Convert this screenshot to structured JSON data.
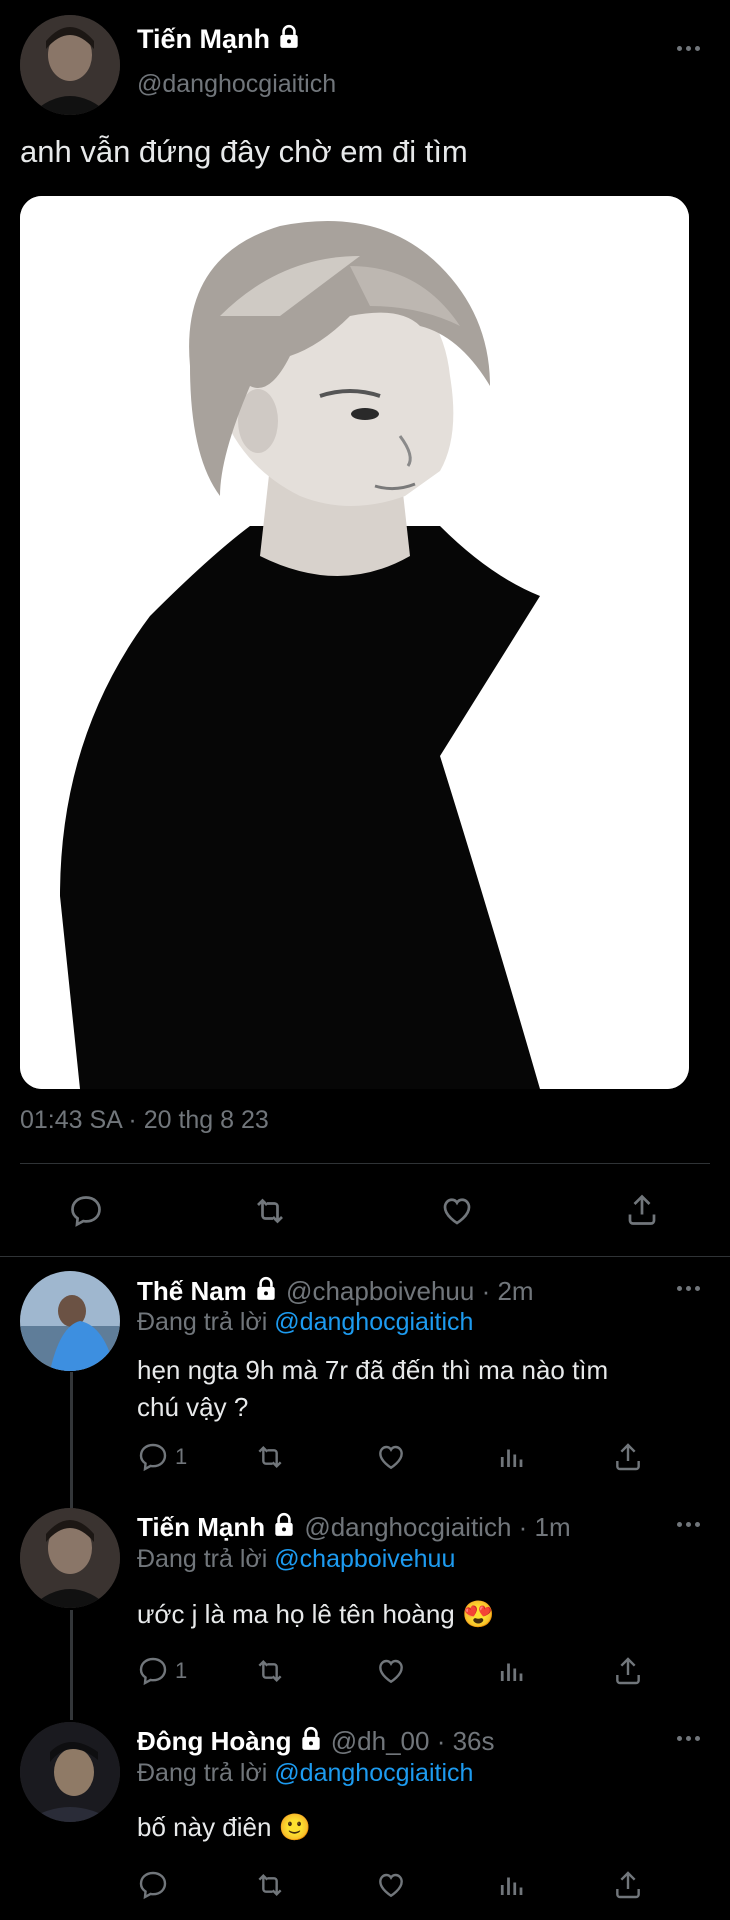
{
  "main_tweet": {
    "display_name": "Tiến Mạnh",
    "handle": "@danghocgiaitich",
    "text": "anh vẫn đứng đây chờ em đi tìm",
    "timestamp": "01:43 SA · 20 thg 8 23"
  },
  "replies": [
    {
      "display_name": "Thế Nam",
      "handle": "@chapboivehuu",
      "time": "· 2m",
      "replying_prefix": "Đang trả lời",
      "replying_to": "@danghocgiaitich",
      "text_line1": "hẹn ngta 9h mà 7r đã đến thì ma nào tìm",
      "text_line2": "chú vậy ?",
      "reply_count": "1"
    },
    {
      "display_name": "Tiến Mạnh",
      "handle": "@danghocgiaitich",
      "time": "· 1m",
      "replying_prefix": "Đang trả lời",
      "replying_to": "@chapboivehuu",
      "text_line1": "ước j là ma họ lê tên hoàng 😍",
      "reply_count": "1"
    },
    {
      "display_name": "Đông Hoàng",
      "handle": "@dh_00",
      "time": "· 36s",
      "replying_prefix": "Đang trả lời",
      "replying_to": "@danghocgiaitich",
      "text_line1": "bố này điên 🙂",
      "reply_count": ""
    }
  ],
  "colors": {
    "background": "#000000",
    "text": "#e7e9ea",
    "muted": "#71767b",
    "link": "#1d9bf0",
    "divider": "#2f3336"
  },
  "icons": [
    "lock-icon",
    "more-icon",
    "reply-icon",
    "retweet-icon",
    "like-icon",
    "share-icon",
    "views-icon"
  ]
}
